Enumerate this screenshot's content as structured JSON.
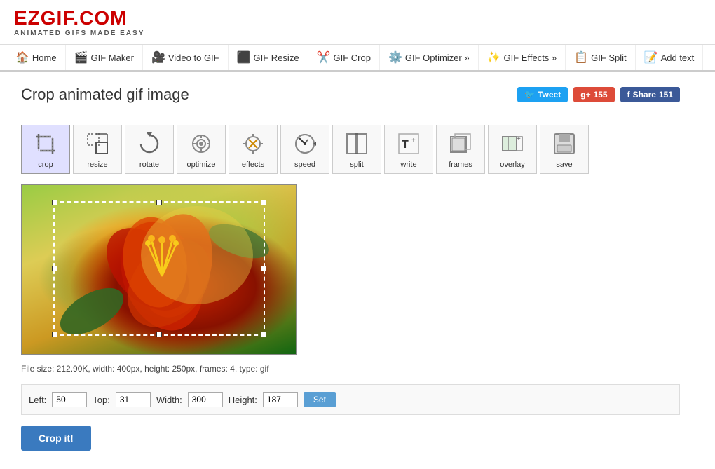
{
  "logo": {
    "text": "EZGIF.COM",
    "subtitle": "ANIMATED GIFS MADE EASY"
  },
  "nav": {
    "items": [
      {
        "id": "home",
        "label": "Home",
        "icon": "🏠"
      },
      {
        "id": "gif-maker",
        "label": "GIF Maker",
        "icon": "🎬"
      },
      {
        "id": "video-to-gif",
        "label": "Video to GIF",
        "icon": "🎥"
      },
      {
        "id": "gif-resize",
        "label": "GIF Resize",
        "icon": "⬛"
      },
      {
        "id": "gif-crop",
        "label": "GIF Crop",
        "icon": "✂️",
        "active": true
      },
      {
        "id": "gif-optimizer",
        "label": "GIF Optimizer »",
        "icon": "⚙️"
      },
      {
        "id": "gif-effects",
        "label": "GIF Effects »",
        "icon": "✨"
      },
      {
        "id": "gif-split",
        "label": "GIF Split",
        "icon": "📋"
      },
      {
        "id": "add-text",
        "label": "Add text",
        "icon": "📝"
      }
    ]
  },
  "page": {
    "title": "Crop animated gif image"
  },
  "social": {
    "tweet_label": "Tweet",
    "gplus_count": "155",
    "share_label": "Share",
    "share_count": "151"
  },
  "tools": [
    {
      "id": "crop",
      "label": "crop",
      "icon": "✂",
      "active": true
    },
    {
      "id": "resize",
      "label": "resize",
      "icon": "⤢"
    },
    {
      "id": "rotate",
      "label": "rotate",
      "icon": "🔄"
    },
    {
      "id": "optimize",
      "label": "optimize",
      "icon": "🔧"
    },
    {
      "id": "effects",
      "label": "effects",
      "icon": "⚡"
    },
    {
      "id": "speed",
      "label": "speed",
      "icon": "⏱"
    },
    {
      "id": "split",
      "label": "split",
      "icon": "✂"
    },
    {
      "id": "write",
      "label": "write",
      "icon": "T+"
    },
    {
      "id": "frames",
      "label": "frames",
      "icon": "🖼"
    },
    {
      "id": "overlay",
      "label": "overlay",
      "icon": "🖼+"
    },
    {
      "id": "save",
      "label": "save",
      "icon": "💾"
    }
  ],
  "file_info": "File size: 212.90K, width: 400px, height: 250px, frames: 4, type: gif",
  "controls": {
    "left_label": "Left:",
    "left_value": "50",
    "top_label": "Top:",
    "top_value": "31",
    "width_label": "Width:",
    "width_value": "300",
    "height_label": "Height:",
    "height_value": "187",
    "set_label": "Set"
  },
  "crop_button": "Crop it!",
  "cursor": "default"
}
